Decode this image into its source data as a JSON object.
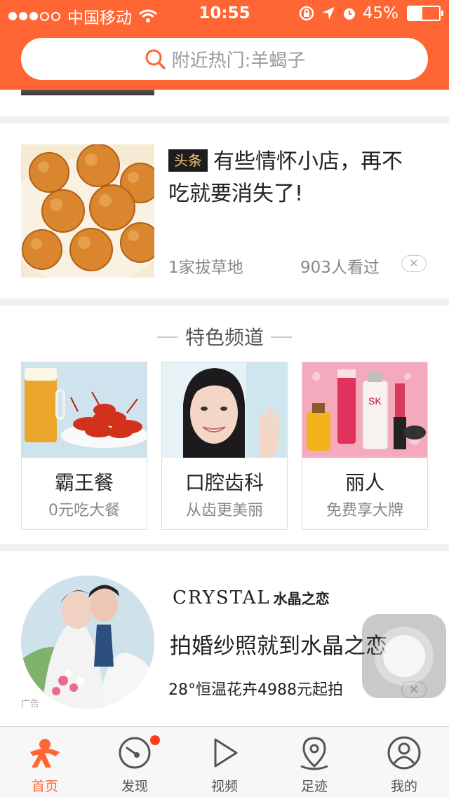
{
  "status_bar": {
    "carrier": "中国移动",
    "time": "10:55",
    "battery_percent": "45%",
    "battery_level": 0.45,
    "signal_bars_filled": 3,
    "signal_bars_total": 5
  },
  "search": {
    "placeholder": "附近热门:羊蝎子"
  },
  "news": {
    "tag": "头条",
    "title": "有些情怀小店，再不吃就要消失了!",
    "source": "1家拔草地",
    "views": "903人看过",
    "close_glyph": "✕"
  },
  "channels": {
    "title": "特色频道",
    "items": [
      {
        "name": "霸王餐",
        "subtitle": "0元吃大餐",
        "icon": "beer-crayfish-image"
      },
      {
        "name": "口腔齿科",
        "subtitle": "从齿更美丽",
        "icon": "smiling-woman-image"
      },
      {
        "name": "丽人",
        "subtitle": "免费享大牌",
        "icon": "cosmetics-image"
      }
    ]
  },
  "ad": {
    "label": "广告",
    "brand_en": "CRYSTAL",
    "brand_cn": "水晶之恋",
    "title": "拍婚纱照就到水晶之恋",
    "subtitle": "28°恒温花卉4988元起拍",
    "close_glyph": "✕"
  },
  "tabs": [
    {
      "label": "首页",
      "icon": "home-person-icon",
      "active": true
    },
    {
      "label": "发现",
      "icon": "discover-icon",
      "active": false,
      "badge": true
    },
    {
      "label": "视频",
      "icon": "video-play-icon",
      "active": false
    },
    {
      "label": "足迹",
      "icon": "location-pin-icon",
      "active": false
    },
    {
      "label": "我的",
      "icon": "user-profile-icon",
      "active": false
    }
  ],
  "colors": {
    "brand": "#ff6633",
    "tag_bg": "#1d1d1d",
    "tag_text": "#f2c768",
    "badge": "#ff3b1f"
  }
}
